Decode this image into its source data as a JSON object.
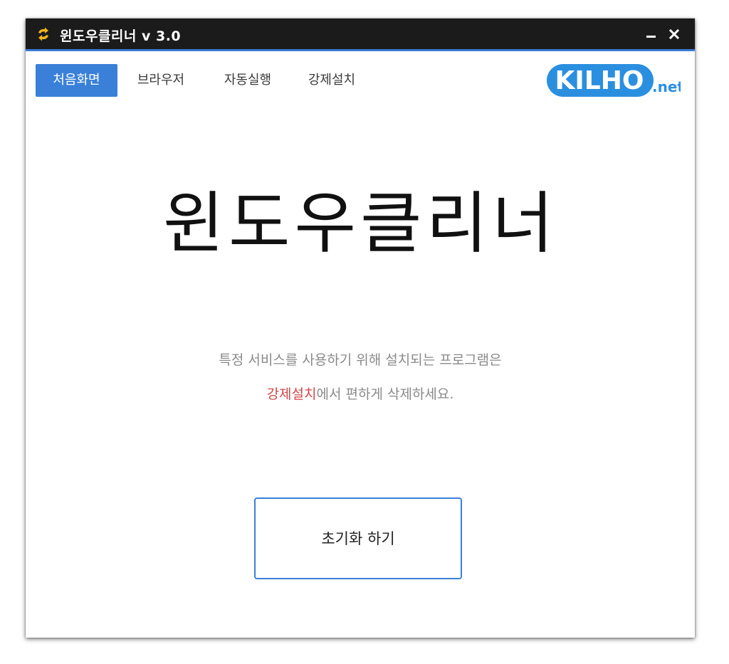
{
  "window": {
    "title": "윈도우클리너 v 3.0",
    "minimize_label": "minimize",
    "close_label": "close"
  },
  "tabs": [
    {
      "label": "처음화면",
      "active": true
    },
    {
      "label": "브라우저",
      "active": false
    },
    {
      "label": "자동실행",
      "active": false
    },
    {
      "label": "강제설치",
      "active": false
    }
  ],
  "logo": {
    "text_main": "KILHO",
    "text_suffix": ".net"
  },
  "main": {
    "title": "윈도우클리너",
    "description_line1": "특정 서비스를 사용하기 위해 설치되는 프로그램은",
    "description_line2_highlight": "강제설치",
    "description_line2_rest": "에서 편하게 삭제하세요.",
    "reset_button_label": "초기화 하기"
  },
  "colors": {
    "titlebar_bg": "#1b1b1b",
    "accent_blue": "#3a80d9",
    "highlight_red": "#d24747",
    "app_icon_yellow": "#f2b51b",
    "logo_blue": "#2b8fe0"
  },
  "icons": {
    "app_icon": "refresh-arrows-icon",
    "minimize": "minimize-icon",
    "close": "close-icon"
  }
}
